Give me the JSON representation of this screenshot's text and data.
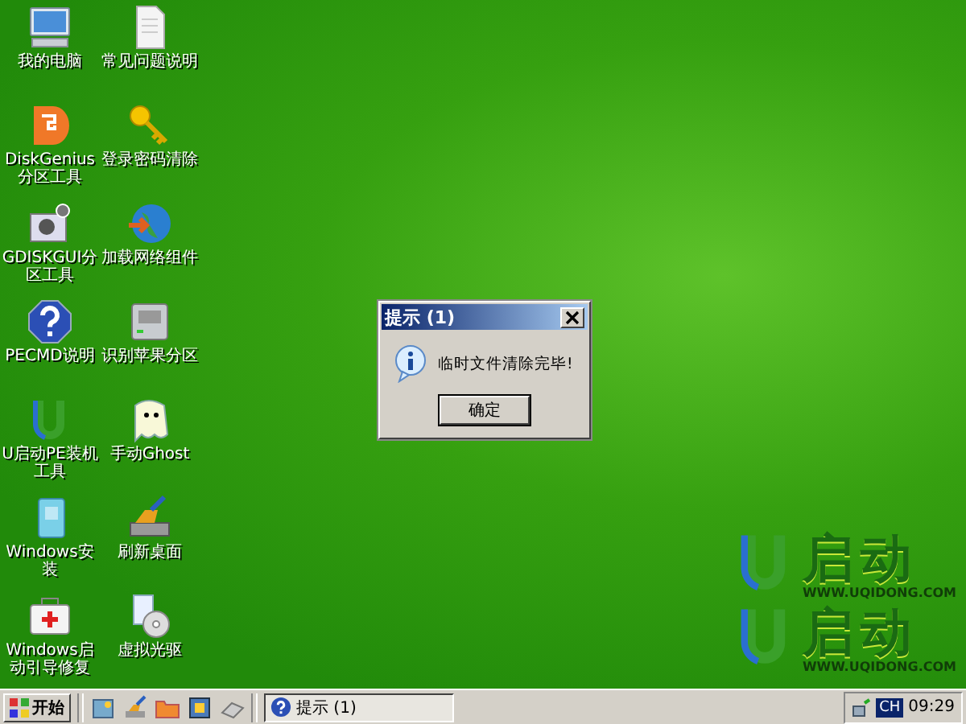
{
  "desktop_icons": [
    {
      "label": "我的电脑",
      "kind": "computer"
    },
    {
      "label": "常见问题说明",
      "kind": "document"
    },
    {
      "label": "DiskGenius分区工具",
      "kind": "partition-app"
    },
    {
      "label": "登录密码清除",
      "kind": "key"
    },
    {
      "label": "GDISKGUI分区工具",
      "kind": "disk-gear"
    },
    {
      "label": "加载网络组件",
      "kind": "globe"
    },
    {
      "label": "PECMD说明",
      "kind": "help"
    },
    {
      "label": "识别苹果分区",
      "kind": "drive"
    },
    {
      "label": "U启动PE装机工具",
      "kind": "u-logo"
    },
    {
      "label": "手动Ghost",
      "kind": "ghost"
    },
    {
      "label": "Windows安装",
      "kind": "install"
    },
    {
      "label": "刷新桌面",
      "kind": "brush"
    },
    {
      "label": "Windows启动引导修复",
      "kind": "medkit"
    },
    {
      "label": "虚拟光驱",
      "kind": "disc"
    }
  ],
  "dialog": {
    "title": "提示 (1)",
    "message": "临时文件清除完毕!",
    "button": "确定"
  },
  "logos": [
    {
      "name": "启动",
      "url": "WWW.UQIDONG.COM"
    },
    {
      "name": "启动",
      "url": "WWW.UQIDONG.COM"
    }
  ],
  "taskbar": {
    "start": "开始",
    "quick_launch": [
      {
        "kind": "picture"
      },
      {
        "kind": "brush"
      },
      {
        "kind": "folder"
      },
      {
        "kind": "frame"
      },
      {
        "kind": "eraser"
      }
    ],
    "tasks": [
      {
        "label": "提示 (1)",
        "selected": true
      }
    ],
    "tray": {
      "language": "CH",
      "clock": "09:29"
    }
  }
}
